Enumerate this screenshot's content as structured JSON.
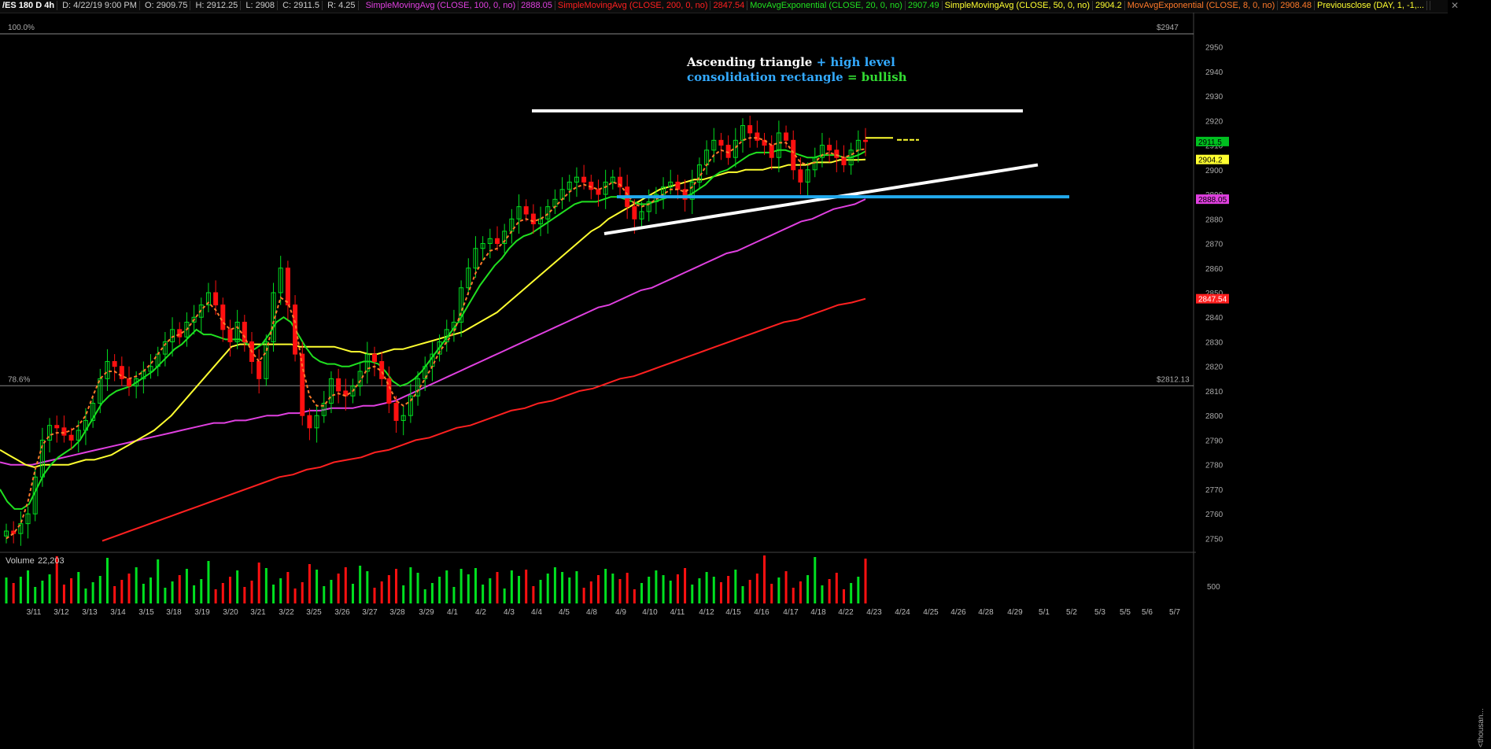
{
  "header": {
    "symbol": "/ES 180 D 4h",
    "date": "D: 4/22/19 9:00 PM",
    "open": "O: 2909.75",
    "high": "H: 2912.25",
    "low": "L: 2908",
    "close": "C: 2911.5",
    "range": "R: 4.25",
    "studies": [
      {
        "label": "SimpleMovingAvg (CLOSE, 100, 0, no)",
        "value": "2888.05",
        "color": "#e040e0"
      },
      {
        "label": "SimpleMovingAvg (CLOSE, 200, 0, no)",
        "value": "2847.54",
        "color": "#ff2020"
      },
      {
        "label": "MovAvgExponential (CLOSE, 20, 0, no)",
        "value": "2907.49",
        "color": "#20e020"
      },
      {
        "label": "SimpleMovingAvg (CLOSE, 50, 0, no)",
        "value": "2904.2",
        "color": "#ffff30"
      },
      {
        "label": "MovAvgExponential (CLOSE, 8, 0, no)",
        "value": "2908.48",
        "color": "#ff7a2a"
      },
      {
        "label": "Previousclose (DAY, 1, -1,...",
        "value": "",
        "color": "#ffff30"
      }
    ]
  },
  "fib": [
    {
      "pct": "100.0%",
      "price_label": "$2947",
      "price": 2947
    },
    {
      "pct": "78.6%",
      "price_label": "$2812.13",
      "price": 2812.13
    }
  ],
  "annotation": {
    "line1_white": "Ascending triangle",
    "line1_blue": "+ high level",
    "line2_blue": "consolidation rectangle",
    "line2_mid": " = ",
    "line2_green": "bullish"
  },
  "volume_panel": {
    "label": "Volume",
    "value": "22,203",
    "axis_label": "500",
    "unit": "<thousan..."
  },
  "colors": {
    "up": "#00e020",
    "down": "#ff1010",
    "sma100": "#e040e0",
    "sma200": "#ff2020",
    "ema20": "#20e020",
    "sma50": "#ffff30",
    "ema8": "#ff7a2a",
    "trend_white": "#ffffff",
    "rect_blue": "#22aaee",
    "prev_close": "#ffff30",
    "annot_blue": "#33aaff",
    "annot_green": "#33dd33"
  },
  "chart_data": {
    "type": "candlestick",
    "y_axis": {
      "min": 2745,
      "max": 2955,
      "ticks": [
        2750,
        2760,
        2770,
        2780,
        2790,
        2800,
        2810,
        2820,
        2830,
        2840,
        2850,
        2860,
        2870,
        2880,
        2890,
        2900,
        2910,
        2920,
        2930,
        2940,
        2950
      ]
    },
    "x_ticks": [
      "3/11",
      "3/12",
      "3/13",
      "3/14",
      "3/15",
      "3/18",
      "3/19",
      "3/20",
      "3/21",
      "3/22",
      "3/25",
      "3/26",
      "3/27",
      "3/28",
      "3/29",
      "4/1",
      "4/2",
      "4/3",
      "4/4",
      "4/5",
      "4/8",
      "4/9",
      "4/10",
      "4/11",
      "4/12",
      "4/15",
      "4/16",
      "4/17",
      "4/18",
      "4/22",
      "4/23",
      "4/24",
      "4/25",
      "4/26",
      "4/28",
      "4/29",
      "5/1",
      "5/2",
      "5/3",
      "5/5",
      "5/6",
      "5/7"
    ],
    "price_labels": [
      {
        "value": 2911.5,
        "text": "2911.5",
        "bg": "#00c020",
        "fg": "#000"
      },
      {
        "value": 2904.2,
        "text": "2904.2",
        "bg": "#ffff30",
        "fg": "#000"
      },
      {
        "value": 2888.05,
        "text": "2888.05",
        "bg": "#e040e0",
        "fg": "#000"
      },
      {
        "value": 2847.54,
        "text": "2847.54",
        "bg": "#ff2020",
        "fg": "#fff"
      }
    ],
    "closes": [
      2753,
      2752,
      2756,
      2760,
      2775,
      2790,
      2796,
      2795,
      2792,
      2790,
      2794,
      2798,
      2805,
      2815,
      2822,
      2820,
      2815,
      2812,
      2815,
      2818,
      2820,
      2825,
      2830,
      2835,
      2832,
      2838,
      2840,
      2845,
      2850,
      2845,
      2835,
      2830,
      2838,
      2830,
      2822,
      2815,
      2830,
      2850,
      2860,
      2845,
      2825,
      2800,
      2795,
      2800,
      2805,
      2815,
      2810,
      2808,
      2812,
      2818,
      2825,
      2822,
      2815,
      2805,
      2798,
      2800,
      2808,
      2815,
      2820,
      2825,
      2830,
      2835,
      2838,
      2852,
      2860,
      2868,
      2870,
      2872,
      2870,
      2875,
      2880,
      2885,
      2882,
      2878,
      2880,
      2885,
      2888,
      2892,
      2895,
      2897,
      2895,
      2892,
      2890,
      2895,
      2897,
      2893,
      2885,
      2880,
      2883,
      2887,
      2890,
      2893,
      2895,
      2892,
      2888,
      2895,
      2902,
      2908,
      2912,
      2910,
      2905,
      2912,
      2918,
      2915,
      2912,
      2910,
      2905,
      2915,
      2912,
      2900,
      2895,
      2900,
      2905,
      2910,
      2908,
      2905,
      2902,
      2908,
      2912,
      2911.5
    ],
    "ema8": [
      2750,
      2752,
      2756,
      2765,
      2778,
      2788,
      2792,
      2793,
      2793,
      2794,
      2796,
      2800,
      2808,
      2815,
      2818,
      2818,
      2816,
      2815,
      2816,
      2818,
      2821,
      2825,
      2829,
      2832,
      2833,
      2835,
      2839,
      2843,
      2846,
      2843,
      2838,
      2835,
      2836,
      2832,
      2826,
      2822,
      2826,
      2838,
      2848,
      2846,
      2838,
      2820,
      2808,
      2804,
      2804,
      2808,
      2809,
      2808,
      2810,
      2814,
      2819,
      2820,
      2818,
      2812,
      2806,
      2804,
      2806,
      2810,
      2815,
      2820,
      2826,
      2830,
      2834,
      2842,
      2850,
      2858,
      2863,
      2867,
      2868,
      2871,
      2875,
      2879,
      2880,
      2879,
      2880,
      2882,
      2885,
      2888,
      2891,
      2893,
      2894,
      2893,
      2892,
      2893,
      2895,
      2894,
      2890,
      2886,
      2885,
      2886,
      2888,
      2890,
      2892,
      2892,
      2891,
      2893,
      2897,
      2902,
      2906,
      2908,
      2907,
      2909,
      2912,
      2913,
      2913,
      2912,
      2910,
      2911,
      2911,
      2907,
      2903,
      2902,
      2903,
      2906,
      2907,
      2906,
      2905,
      2906,
      2908,
      2908.5
    ],
    "ema20": [
      2770,
      2765,
      2762,
      2762,
      2764,
      2770,
      2776,
      2780,
      2783,
      2785,
      2787,
      2790,
      2795,
      2800,
      2805,
      2808,
      2810,
      2811,
      2812,
      2814,
      2816,
      2818,
      2821,
      2824,
      2827,
      2829,
      2832,
      2835,
      2833,
      2833,
      2832,
      2831,
      2831,
      2831,
      2829,
      2827,
      2829,
      2833,
      2838,
      2840,
      2838,
      2833,
      2828,
      2824,
      2822,
      2821,
      2821,
      2820,
      2820,
      2821,
      2822,
      2822,
      2821,
      2818,
      2814,
      2812,
      2813,
      2815,
      2818,
      2822,
      2826,
      2830,
      2834,
      2838,
      2843,
      2848,
      2853,
      2857,
      2861,
      2864,
      2868,
      2871,
      2873,
      2874,
      2876,
      2878,
      2880,
      2882,
      2884,
      2886,
      2887,
      2887,
      2887,
      2888,
      2889,
      2889,
      2888,
      2887,
      2886,
      2886,
      2887,
      2888,
      2889,
      2889,
      2889,
      2890,
      2892,
      2894,
      2897,
      2899,
      2900,
      2902,
      2904,
      2906,
      2907,
      2907,
      2907,
      2908,
      2908,
      2907,
      2906,
      2905,
      2905,
      2906,
      2906,
      2906,
      2905,
      2905,
      2906,
      2907.49
    ],
    "sma50": [
      2786,
      2784,
      2782,
      2780,
      2779,
      2780,
      2780,
      2780,
      2780,
      2781,
      2782,
      2782,
      2783,
      2784,
      2786,
      2788,
      2790,
      2792,
      2794,
      2797,
      2800,
      2804,
      2808,
      2812,
      2816,
      2820,
      2824,
      2828,
      2829,
      2829,
      2829,
      2829,
      2829,
      2829,
      2829,
      2828,
      2828,
      2828,
      2828,
      2828,
      2827,
      2826,
      2826,
      2825,
      2825,
      2826,
      2827,
      2827,
      2828,
      2829,
      2830,
      2831,
      2832,
      2833,
      2834,
      2836,
      2838,
      2840,
      2842,
      2845,
      2848,
      2851,
      2854,
      2857,
      2860,
      2863,
      2866,
      2869,
      2872,
      2875,
      2877,
      2880,
      2882,
      2884,
      2886,
      2888,
      2890,
      2892,
      2893,
      2894,
      2895,
      2896,
      2896,
      2897,
      2898,
      2899,
      2899,
      2900,
      2900,
      2900,
      2901,
      2901,
      2902,
      2902,
      2902,
      2903,
      2903,
      2903,
      2904,
      2904,
      2904,
      2904.2
    ],
    "sma100": [
      2781,
      2780,
      2780,
      2780,
      2781,
      2782,
      2783,
      2784,
      2785,
      2786,
      2787,
      2788,
      2789,
      2790,
      2791,
      2792,
      2793,
      2794,
      2795,
      2796,
      2797,
      2797,
      2798,
      2798,
      2799,
      2800,
      2800,
      2801,
      2801,
      2802,
      2802,
      2803,
      2803,
      2803,
      2804,
      2804,
      2805,
      2806,
      2808,
      2810,
      2812,
      2814,
      2816,
      2818,
      2820,
      2822,
      2824,
      2826,
      2828,
      2830,
      2832,
      2834,
      2836,
      2838,
      2840,
      2842,
      2844,
      2845,
      2847,
      2849,
      2851,
      2852,
      2854,
      2856,
      2858,
      2860,
      2862,
      2864,
      2866,
      2867,
      2869,
      2871,
      2873,
      2875,
      2877,
      2879,
      2880,
      2882,
      2884,
      2885,
      2886,
      2888.05
    ],
    "sma200": [
      2749,
      2751,
      2753,
      2755,
      2757,
      2759,
      2761,
      2763,
      2765,
      2767,
      2769,
      2771,
      2773,
      2775,
      2776,
      2778,
      2779,
      2781,
      2782,
      2783,
      2785,
      2786,
      2788,
      2790,
      2791,
      2793,
      2795,
      2796,
      2798,
      2800,
      2802,
      2803,
      2805,
      2806,
      2808,
      2810,
      2811,
      2813,
      2815,
      2816,
      2818,
      2820,
      2822,
      2824,
      2826,
      2828,
      2830,
      2832,
      2834,
      2836,
      2838,
      2839,
      2841,
      2843,
      2845,
      2846,
      2847.54
    ],
    "trendlines": [
      {
        "name": "triangle-top",
        "x1_date": "4/4",
        "x2_date": "5/1",
        "y1": 2924,
        "y2": 2924,
        "color": "white"
      },
      {
        "name": "triangle-bottom",
        "x1_date": "4/8",
        "x2_date": "4/29",
        "y1": 2874,
        "y2": 2902,
        "color": "white"
      },
      {
        "name": "consolidation-support",
        "x1_date": "4/9",
        "x2_date": "5/2",
        "y1": 2889,
        "y2": 2889,
        "color": "blue"
      }
    ],
    "prev_close_level": 2913
  }
}
